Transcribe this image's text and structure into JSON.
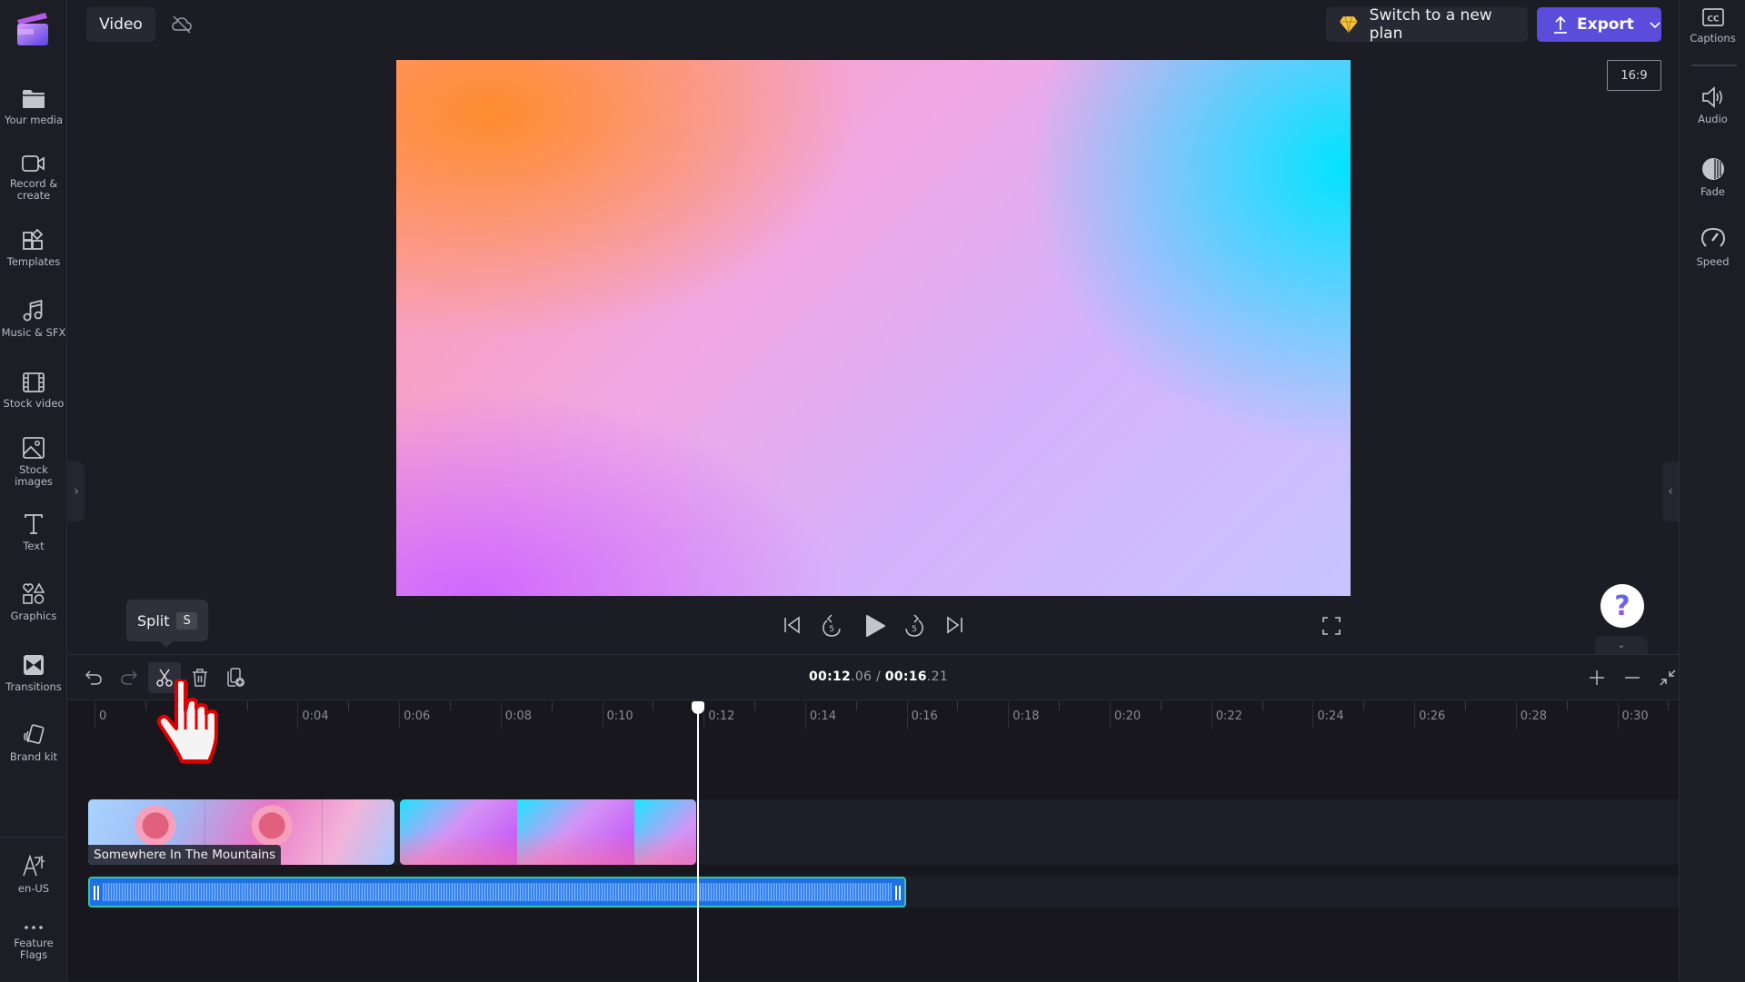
{
  "app": {
    "brand_colors": {
      "accent": "#5b4ddb",
      "background": "#1c1c24",
      "audio_clip": "#1f6fe8",
      "audio_border": "#2fc8a0"
    }
  },
  "topbar": {
    "tab_label": "Video",
    "cloud_status_icon": "cloud-off-icon",
    "plan_button_label": "Switch to a new plan",
    "plan_button_icon": "diamond-icon",
    "export_button_label": "Export",
    "export_icon": "upload-icon"
  },
  "sidebar": {
    "items": [
      {
        "label": "Your media",
        "icon": "folder-icon"
      },
      {
        "label": "Record & create",
        "icon": "video-camera-icon"
      },
      {
        "label": "Templates",
        "icon": "templates-icon"
      },
      {
        "label": "Music & SFX",
        "icon": "music-note-icon"
      },
      {
        "label": "Stock video",
        "icon": "film-icon"
      },
      {
        "label": "Stock images",
        "icon": "image-icon"
      },
      {
        "label": "Text",
        "icon": "text-icon"
      },
      {
        "label": "Graphics",
        "icon": "shapes-icon"
      },
      {
        "label": "Transitions",
        "icon": "transition-icon"
      },
      {
        "label": "Brand kit",
        "icon": "brand-kit-icon"
      }
    ],
    "bottom_items": [
      {
        "label": "en-US",
        "icon": "language-icon"
      },
      {
        "label": "Feature Flags",
        "icon": "more-icon"
      }
    ]
  },
  "rightpanel": {
    "items": [
      {
        "label": "Captions",
        "icon": "captions-icon"
      },
      {
        "label": "Audio",
        "icon": "speaker-icon"
      },
      {
        "label": "Fade",
        "icon": "fade-icon"
      },
      {
        "label": "Speed",
        "icon": "speedometer-icon"
      }
    ]
  },
  "preview": {
    "aspect_ratio": "16:9",
    "controls": [
      "skip-to-start",
      "rewind-5",
      "play",
      "forward-5",
      "skip-to-end"
    ],
    "fullscreen_icon": "fullscreen-icon",
    "help_label": "?"
  },
  "timeline": {
    "tooltip": {
      "label": "Split",
      "shortcut": "S"
    },
    "current_time_main": "00:12",
    "current_time_frac": ".06",
    "separator": " / ",
    "total_time_main": "00:16",
    "total_time_frac": ".21",
    "ruler_labels": [
      "0",
      "",
      "0:04",
      "0:06",
      "0:08",
      "0:10",
      "0:12",
      "0:14",
      "0:16",
      "0:18",
      "0:20",
      "0:22",
      "0:24",
      "0:26",
      "0:28",
      "0:30"
    ],
    "playhead_seconds": 12.06,
    "video_clips": [
      {
        "name": "Somewhere In The Mountains",
        "start_s": 0,
        "end_s": 6.0
      },
      {
        "name": "",
        "start_s": 6.1,
        "end_s": 11.95
      }
    ],
    "audio_clip": {
      "start_s": 0,
      "end_s": 16.1
    }
  }
}
